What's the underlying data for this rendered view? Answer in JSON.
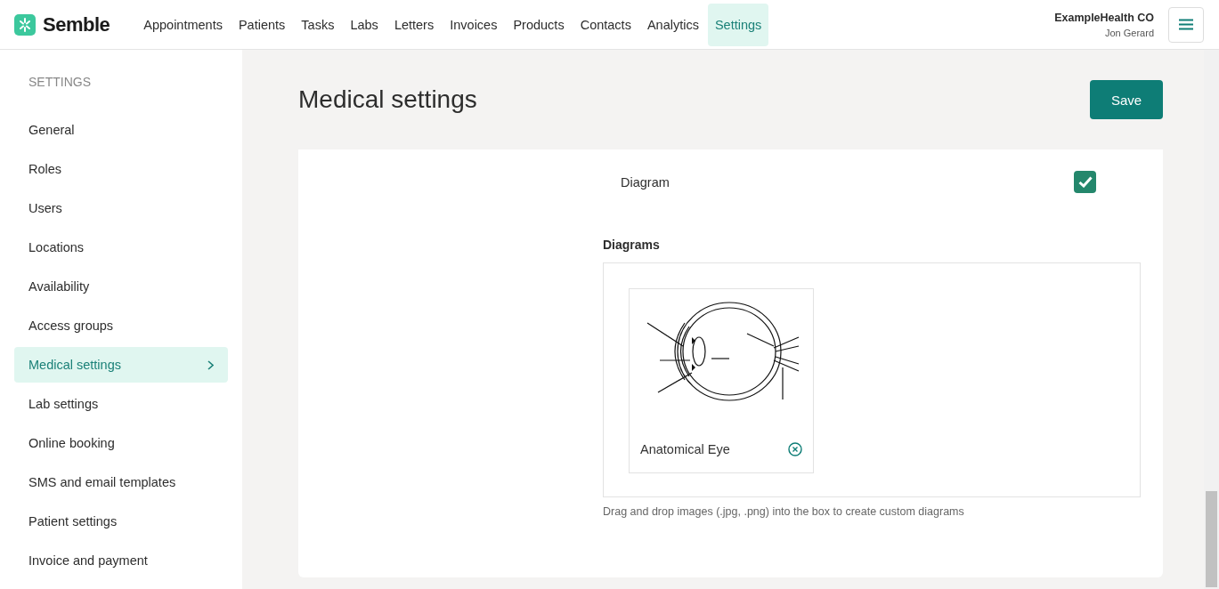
{
  "nav": {
    "logo": "Semble",
    "items": [
      {
        "label": "Appointments",
        "selected": false
      },
      {
        "label": "Patients",
        "selected": false
      },
      {
        "label": "Tasks",
        "selected": false
      },
      {
        "label": "Labs",
        "selected": false
      },
      {
        "label": "Letters",
        "selected": false
      },
      {
        "label": "Invoices",
        "selected": false
      },
      {
        "label": "Products",
        "selected": false
      },
      {
        "label": "Contacts",
        "selected": false
      },
      {
        "label": "Analytics",
        "selected": false
      },
      {
        "label": "Settings",
        "selected": true
      }
    ],
    "org": "ExampleHealth CO",
    "user": "Jon Gerard"
  },
  "sidebar": {
    "heading": "SETTINGS",
    "items": [
      {
        "label": "General",
        "selected": false
      },
      {
        "label": "Roles",
        "selected": false
      },
      {
        "label": "Users",
        "selected": false
      },
      {
        "label": "Locations",
        "selected": false
      },
      {
        "label": "Availability",
        "selected": false
      },
      {
        "label": "Access groups",
        "selected": false
      },
      {
        "label": "Medical settings",
        "selected": true
      },
      {
        "label": "Lab settings",
        "selected": false
      },
      {
        "label": "Online booking",
        "selected": false
      },
      {
        "label": "SMS and email templates",
        "selected": false
      },
      {
        "label": "Patient settings",
        "selected": false
      },
      {
        "label": "Invoice and payment",
        "selected": false
      }
    ]
  },
  "page": {
    "title": "Medical settings",
    "save_button": "Save"
  },
  "setting": {
    "label": "Diagram",
    "checked": true
  },
  "diagrams": {
    "heading": "Diagrams",
    "items": [
      {
        "name": "Anatomical Eye"
      }
    ],
    "hint": "Drag and drop images (.jpg, .png) into the box to create custom diagrams"
  }
}
